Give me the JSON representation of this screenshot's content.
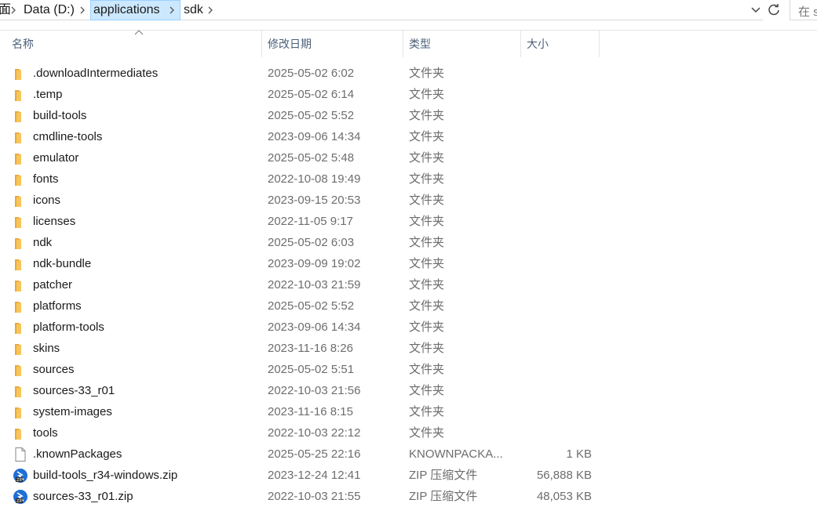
{
  "address": {
    "crumbs": [
      {
        "label": "面",
        "highlighted": false
      },
      {
        "label": "Data (D:)",
        "highlighted": false
      },
      {
        "label": "applications",
        "highlighted": true
      },
      {
        "label": "sdk",
        "highlighted": false
      }
    ],
    "search_placeholder": "在 s"
  },
  "columns": {
    "name": "名称",
    "date": "修改日期",
    "type": "类型",
    "size": "大小"
  },
  "colors": {
    "folder": "#f8c55a",
    "folder_dark": "#e8a93b",
    "highlight": "#cce8ff",
    "header_text": "#4c607a"
  },
  "rows": [
    {
      "name": ".downloadIntermediates",
      "date": "2025-05-02 6:02",
      "type": "文件夹",
      "size": "",
      "icon": "folder-icon"
    },
    {
      "name": ".temp",
      "date": "2025-05-02 6:14",
      "type": "文件夹",
      "size": "",
      "icon": "folder-icon"
    },
    {
      "name": "build-tools",
      "date": "2025-05-02 5:52",
      "type": "文件夹",
      "size": "",
      "icon": "folder-icon"
    },
    {
      "name": "cmdline-tools",
      "date": "2023-09-06 14:34",
      "type": "文件夹",
      "size": "",
      "icon": "folder-icon"
    },
    {
      "name": "emulator",
      "date": "2025-05-02 5:48",
      "type": "文件夹",
      "size": "",
      "icon": "folder-icon"
    },
    {
      "name": "fonts",
      "date": "2022-10-08 19:49",
      "type": "文件夹",
      "size": "",
      "icon": "folder-icon"
    },
    {
      "name": "icons",
      "date": "2023-09-15 20:53",
      "type": "文件夹",
      "size": "",
      "icon": "folder-icon"
    },
    {
      "name": "licenses",
      "date": "2022-11-05 9:17",
      "type": "文件夹",
      "size": "",
      "icon": "folder-icon"
    },
    {
      "name": "ndk",
      "date": "2025-05-02 6:03",
      "type": "文件夹",
      "size": "",
      "icon": "folder-icon"
    },
    {
      "name": "ndk-bundle",
      "date": "2023-09-09 19:02",
      "type": "文件夹",
      "size": "",
      "icon": "folder-icon"
    },
    {
      "name": "patcher",
      "date": "2022-10-03 21:59",
      "type": "文件夹",
      "size": "",
      "icon": "folder-icon"
    },
    {
      "name": "platforms",
      "date": "2025-05-02 5:52",
      "type": "文件夹",
      "size": "",
      "icon": "folder-icon"
    },
    {
      "name": "platform-tools",
      "date": "2023-09-06 14:34",
      "type": "文件夹",
      "size": "",
      "icon": "folder-icon"
    },
    {
      "name": "skins",
      "date": "2023-11-16 8:26",
      "type": "文件夹",
      "size": "",
      "icon": "folder-icon"
    },
    {
      "name": "sources",
      "date": "2025-05-02 5:51",
      "type": "文件夹",
      "size": "",
      "icon": "folder-icon"
    },
    {
      "name": "sources-33_r01",
      "date": "2022-10-03 21:56",
      "type": "文件夹",
      "size": "",
      "icon": "folder-icon"
    },
    {
      "name": "system-images",
      "date": "2023-11-16 8:15",
      "type": "文件夹",
      "size": "",
      "icon": "folder-icon"
    },
    {
      "name": "tools",
      "date": "2022-10-03 22:12",
      "type": "文件夹",
      "size": "",
      "icon": "folder-icon"
    },
    {
      "name": ".knownPackages",
      "date": "2025-05-25 22:16",
      "type": "KNOWNPACKA...",
      "size": "1 KB",
      "icon": "file-icon"
    },
    {
      "name": "build-tools_r34-windows.zip",
      "date": "2023-12-24 12:41",
      "type": "ZIP 压缩文件",
      "size": "56,888 KB",
      "icon": "zip-icon"
    },
    {
      "name": "sources-33_r01.zip",
      "date": "2022-10-03 21:55",
      "type": "ZIP 压缩文件",
      "size": "48,053 KB",
      "icon": "zip-icon"
    }
  ]
}
